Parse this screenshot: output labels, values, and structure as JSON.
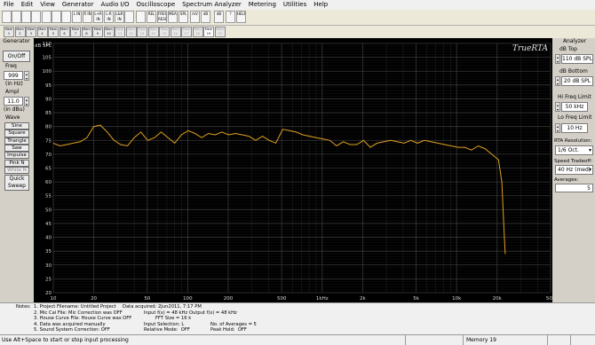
{
  "menu": [
    "File",
    "Edit",
    "View",
    "Generator",
    "Audio I/O",
    "Oscilloscope",
    "Spectrum Analyzer",
    "Metering",
    "Utilities",
    "Help"
  ],
  "toolbar": {
    "buttons": [
      "",
      "",
      "",
      "",
      "",
      "",
      "",
      "L IN",
      "R IN",
      "L+R IN",
      "L-R IN",
      "L&R IN",
      "",
      "",
      "REL",
      "FREQ RESP",
      "MEAS",
      "SPL",
      "mV",
      "dB",
      "dB",
      "?",
      "HELP"
    ]
  },
  "memory_bar": {
    "buttons": [
      {
        "top": "Mem",
        "bottom": "1"
      },
      {
        "top": "Mem",
        "bottom": "2"
      },
      {
        "top": "Mem",
        "bottom": "3"
      },
      {
        "top": "Mem",
        "bottom": "4"
      },
      {
        "top": "Mem",
        "bottom": "5"
      },
      {
        "top": "Mem",
        "bottom": "6"
      },
      {
        "top": "Mem",
        "bottom": "7"
      },
      {
        "top": "Mem",
        "bottom": "8"
      },
      {
        "top": "Mem",
        "bottom": "9"
      },
      {
        "top": "Mem",
        "bottom": "10"
      },
      {
        "top": "Mem",
        "bottom": "11"
      },
      {
        "top": "Mem",
        "bottom": "12"
      },
      {
        "top": "Mem",
        "bottom": "13"
      },
      {
        "top": "Mem",
        "bottom": "14"
      },
      {
        "top": "Mem",
        "bottom": "15"
      },
      {
        "top": "Mem",
        "bottom": "16"
      },
      {
        "top": "Mem",
        "bottom": "17"
      },
      {
        "top": "Mem",
        "bottom": "18"
      },
      {
        "top": "Mem",
        "bottom": "19"
      },
      {
        "top": "Mem",
        "bottom": "20"
      }
    ]
  },
  "generator": {
    "title": "Generator",
    "on_off": "On/Off",
    "freq_label": "Freq",
    "freq_value": "999",
    "freq_unit": "(in Hz)",
    "ampl_label": "Ampl",
    "ampl_value": "11.0",
    "ampl_unit": "(in dBu)",
    "wave_label": "Wave",
    "waves": [
      "Sine",
      "Square",
      "Triangle",
      "Saw",
      "Impulse",
      "Pink N",
      "White N"
    ],
    "quick_sweep": "Quick Sweep"
  },
  "analyzer": {
    "title": "Analyzer",
    "db_top_label": "dB Top",
    "db_top_value": "110 dB SPL",
    "db_bottom_label": "dB Bottom",
    "db_bottom_value": "20 dB SPL",
    "hi_freq_label": "Hi Freq Limit",
    "hi_freq_value": "50 kHz",
    "lo_freq_label": "Lo Freq Limit",
    "lo_freq_value": "10 Hz",
    "rta_res_label": "RTA Resolution:",
    "rta_res_value": "1/6 Oct.",
    "speed_label": "Speed Tradeoff:",
    "speed_value": "40 Hz (med)",
    "averages_label": "Averages:",
    "averages_value": "5"
  },
  "chart_data": {
    "type": "line",
    "brand": "TrueRTA",
    "ylabel": "dB SPL",
    "ylim": [
      20,
      110
    ],
    "yticks": [
      110,
      105,
      100,
      95,
      90,
      85,
      80,
      75,
      70,
      65,
      60,
      55,
      50,
      45,
      40,
      35,
      30,
      25,
      20
    ],
    "xscale": "log",
    "xlim": [
      10,
      50000
    ],
    "xticks": [
      {
        "v": 10,
        "label": "10"
      },
      {
        "v": 20,
        "label": "20"
      },
      {
        "v": 50,
        "label": "50"
      },
      {
        "v": 100,
        "label": "100"
      },
      {
        "v": 200,
        "label": "200"
      },
      {
        "v": 500,
        "label": "500"
      },
      {
        "v": 1000,
        "label": "1kHz"
      },
      {
        "v": 2000,
        "label": "2k"
      },
      {
        "v": 5000,
        "label": "5k"
      },
      {
        "v": 10000,
        "label": "10k"
      },
      {
        "v": 20000,
        "label": "20k"
      },
      {
        "v": 50000,
        "label": "50k"
      }
    ],
    "series": [
      {
        "color": "#e0a020",
        "x": [
          10,
          11.2,
          12.6,
          14.1,
          15.9,
          17.8,
          20,
          22.4,
          25.2,
          28.3,
          31.7,
          35.6,
          40,
          44.9,
          50.4,
          56.6,
          63.5,
          71.3,
          80,
          89.8,
          100.8,
          113.1,
          127,
          142.5,
          160,
          179.6,
          201.6,
          226.3,
          254,
          285.1,
          320,
          359.2,
          403.2,
          452.5,
          508,
          570,
          640,
          718,
          806,
          905,
          1016,
          1140,
          1280,
          1437,
          1613,
          1810,
          2032,
          2281,
          2560,
          2874,
          3225,
          3620,
          4063,
          4561,
          5120,
          5747,
          6450,
          7241,
          8127,
          9123,
          10240,
          11494,
          12902,
          14482,
          16255,
          18246,
          20480,
          21700,
          22400,
          23000
        ],
        "y": [
          74,
          73,
          73.5,
          74,
          74.5,
          76,
          80,
          80.5,
          78,
          75,
          73.5,
          73,
          76,
          78,
          75,
          76,
          78,
          76,
          74,
          77,
          78.5,
          77.5,
          76,
          77.5,
          77,
          78,
          77,
          77.5,
          77,
          76.5,
          75,
          76.5,
          75,
          74,
          79,
          78.5,
          78,
          77,
          76.5,
          76,
          75.5,
          75,
          73,
          74.5,
          73.5,
          73.5,
          75,
          72.5,
          74,
          74.5,
          75,
          74.5,
          74,
          75,
          74,
          75,
          74.5,
          74,
          73.5,
          73,
          72.5,
          72.5,
          71.5,
          73,
          72,
          70,
          68,
          60,
          45,
          34
        ]
      }
    ]
  },
  "notes": {
    "label": "Notes:",
    "project": "1. Project Filename: Untitled Project",
    "mic_cal": "2. Mic Cal File: Mic Correction was OFF",
    "house_curve": "3. House Curve File: House Curve was OFF",
    "acquired_manually": "4. Data was acquired manually",
    "sound_system": "5. Sound System Correction: OFF",
    "data_acquired": "Data acquired: 2Jun2011, 7:17 PM",
    "input_fs": "Input f(s) = 48 kHz",
    "output_fs": "Output f(s) = 48 kHz",
    "fft_size": "FFT Size = 16 k",
    "input_selection": "Input Selection: L",
    "relative_mode": "Relative Mode:  OFF",
    "num_averages": "No. of Averages = 5",
    "peak_hold": "Peak Hold:  OFF"
  },
  "status": {
    "hint": "Use Alt+Space to start or stop input processing",
    "memory": "Memory 19"
  }
}
